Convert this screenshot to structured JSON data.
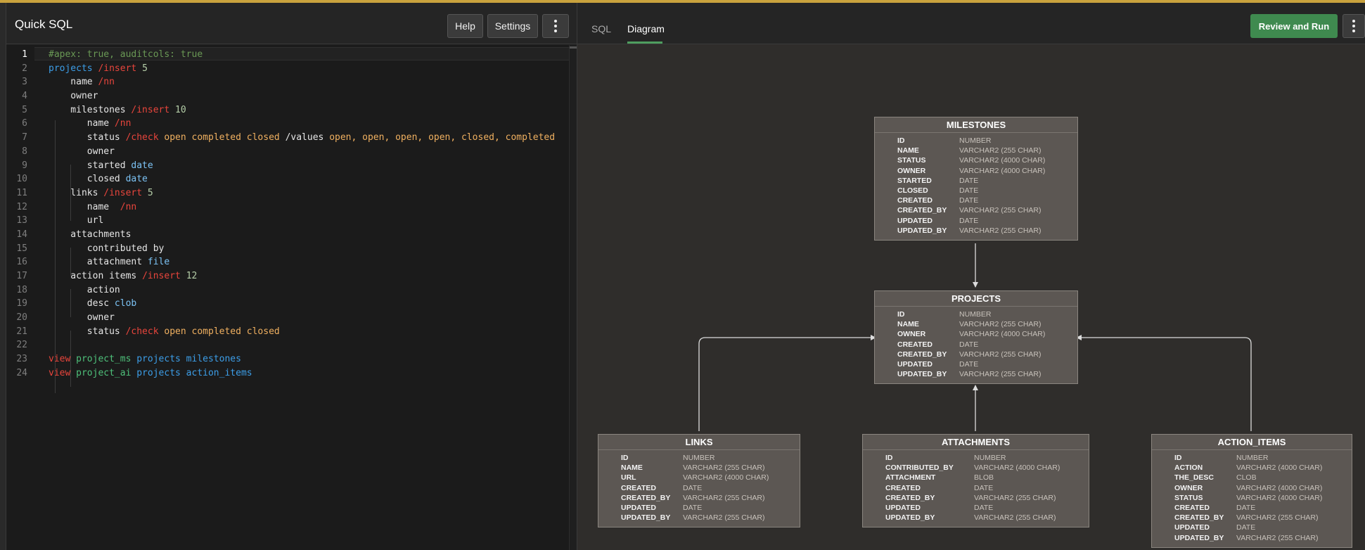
{
  "app": {
    "title": "Quick SQL"
  },
  "toolbar": {
    "help_label": "Help",
    "settings_label": "Settings",
    "more_icon": "kebab-vertical-icon"
  },
  "editor": {
    "line_numbers": [
      "1",
      "2",
      "3",
      "4",
      "5",
      "6",
      "7",
      "8",
      "9",
      "10",
      "11",
      "12",
      "13",
      "14",
      "15",
      "16",
      "17",
      "18",
      "19",
      "20",
      "21",
      "22",
      "23",
      "24"
    ],
    "lines": [
      [
        {
          "t": "#apex: true, auditcols: true",
          "c": "comment"
        }
      ],
      [
        {
          "t": "projects ",
          "c": "table"
        },
        {
          "t": "/insert ",
          "c": "directive"
        },
        {
          "t": "5",
          "c": "number"
        }
      ],
      [
        {
          "t": "    name ",
          "c": "plain"
        },
        {
          "t": "/nn",
          "c": "directive"
        }
      ],
      [
        {
          "t": "    owner",
          "c": "plain"
        }
      ],
      [
        {
          "t": "    milestones ",
          "c": "plain"
        },
        {
          "t": "/insert ",
          "c": "directive"
        },
        {
          "t": "10",
          "c": "number"
        }
      ],
      [
        {
          "t": "       name ",
          "c": "plain"
        },
        {
          "t": "/nn",
          "c": "directive"
        }
      ],
      [
        {
          "t": "       status ",
          "c": "plain"
        },
        {
          "t": "/check ",
          "c": "directive"
        },
        {
          "t": "open completed closed ",
          "c": "value"
        },
        {
          "t": "/values ",
          "c": "plain"
        },
        {
          "t": "open, open, open, open, closed, completed",
          "c": "value"
        }
      ],
      [
        {
          "t": "       owner",
          "c": "plain"
        }
      ],
      [
        {
          "t": "       started ",
          "c": "plain"
        },
        {
          "t": "date",
          "c": "type"
        }
      ],
      [
        {
          "t": "       closed ",
          "c": "plain"
        },
        {
          "t": "date",
          "c": "type"
        }
      ],
      [
        {
          "t": "    links ",
          "c": "plain"
        },
        {
          "t": "/insert ",
          "c": "directive"
        },
        {
          "t": "5",
          "c": "number"
        }
      ],
      [
        {
          "t": "       name  ",
          "c": "plain"
        },
        {
          "t": "/nn",
          "c": "directive"
        }
      ],
      [
        {
          "t": "       url",
          "c": "plain"
        }
      ],
      [
        {
          "t": "    attachments",
          "c": "plain"
        }
      ],
      [
        {
          "t": "       contributed by",
          "c": "plain"
        }
      ],
      [
        {
          "t": "       attachment ",
          "c": "plain"
        },
        {
          "t": "file",
          "c": "type"
        }
      ],
      [
        {
          "t": "    action items ",
          "c": "plain"
        },
        {
          "t": "/insert ",
          "c": "directive"
        },
        {
          "t": "12",
          "c": "number"
        }
      ],
      [
        {
          "t": "       action",
          "c": "plain"
        }
      ],
      [
        {
          "t": "       desc ",
          "c": "plain"
        },
        {
          "t": "clob",
          "c": "type"
        }
      ],
      [
        {
          "t": "       owner",
          "c": "plain"
        }
      ],
      [
        {
          "t": "       status ",
          "c": "plain"
        },
        {
          "t": "/check ",
          "c": "directive"
        },
        {
          "t": "open completed closed",
          "c": "value"
        }
      ],
      [],
      [
        {
          "t": "view ",
          "c": "view"
        },
        {
          "t": "project_ms ",
          "c": "viewname"
        },
        {
          "t": "projects milestones",
          "c": "table"
        }
      ],
      [
        {
          "t": "view ",
          "c": "view"
        },
        {
          "t": "project_ai ",
          "c": "viewname"
        },
        {
          "t": "projects action_items",
          "c": "table"
        }
      ]
    ]
  },
  "tabs": {
    "sql": "SQL",
    "diagram": "Diagram",
    "active": "Diagram"
  },
  "actions": {
    "review_run_label": "Review and Run"
  },
  "colors": {
    "accent_green": "#3f8a4f",
    "window_border": "#c9a23d",
    "comment": "#6a9955",
    "table": "#3c9ee8",
    "directive": "#e8453c",
    "number": "#b5cea8",
    "type": "#7cc3f5",
    "value": "#f0b060"
  },
  "diagram": {
    "entities": [
      {
        "key": "milestones",
        "name": "MILESTONES",
        "columns": [
          {
            "name": "ID",
            "type": "NUMBER"
          },
          {
            "name": "NAME",
            "type": "VARCHAR2 (255 CHAR)"
          },
          {
            "name": "STATUS",
            "type": "VARCHAR2 (4000 CHAR)"
          },
          {
            "name": "OWNER",
            "type": "VARCHAR2 (4000 CHAR)"
          },
          {
            "name": "STARTED",
            "type": "DATE"
          },
          {
            "name": "CLOSED",
            "type": "DATE"
          },
          {
            "name": "CREATED",
            "type": "DATE"
          },
          {
            "name": "CREATED_BY",
            "type": "VARCHAR2 (255 CHAR)"
          },
          {
            "name": "UPDATED",
            "type": "DATE"
          },
          {
            "name": "UPDATED_BY",
            "type": "VARCHAR2 (255 CHAR)"
          }
        ]
      },
      {
        "key": "projects",
        "name": "PROJECTS",
        "columns": [
          {
            "name": "ID",
            "type": "NUMBER"
          },
          {
            "name": "NAME",
            "type": "VARCHAR2 (255 CHAR)"
          },
          {
            "name": "OWNER",
            "type": "VARCHAR2 (4000 CHAR)"
          },
          {
            "name": "CREATED",
            "type": "DATE"
          },
          {
            "name": "CREATED_BY",
            "type": "VARCHAR2 (255 CHAR)"
          },
          {
            "name": "UPDATED",
            "type": "DATE"
          },
          {
            "name": "UPDATED_BY",
            "type": "VARCHAR2 (255 CHAR)"
          }
        ]
      },
      {
        "key": "links",
        "name": "LINKS",
        "columns": [
          {
            "name": "ID",
            "type": "NUMBER"
          },
          {
            "name": "NAME",
            "type": "VARCHAR2 (255 CHAR)"
          },
          {
            "name": "URL",
            "type": "VARCHAR2 (4000 CHAR)"
          },
          {
            "name": "CREATED",
            "type": "DATE"
          },
          {
            "name": "CREATED_BY",
            "type": "VARCHAR2 (255 CHAR)"
          },
          {
            "name": "UPDATED",
            "type": "DATE"
          },
          {
            "name": "UPDATED_BY",
            "type": "VARCHAR2 (255 CHAR)"
          }
        ]
      },
      {
        "key": "attachments",
        "name": "ATTACHMENTS",
        "columns": [
          {
            "name": "ID",
            "type": "NUMBER"
          },
          {
            "name": "CONTRIBUTED_BY",
            "type": "VARCHAR2 (4000 CHAR)"
          },
          {
            "name": "ATTACHMENT",
            "type": "BLOB"
          },
          {
            "name": "CREATED",
            "type": "DATE"
          },
          {
            "name": "CREATED_BY",
            "type": "VARCHAR2 (255 CHAR)"
          },
          {
            "name": "UPDATED",
            "type": "DATE"
          },
          {
            "name": "UPDATED_BY",
            "type": "VARCHAR2 (255 CHAR)"
          }
        ]
      },
      {
        "key": "action_items",
        "name": "ACTION_ITEMS",
        "columns": [
          {
            "name": "ID",
            "type": "NUMBER"
          },
          {
            "name": "ACTION",
            "type": "VARCHAR2 (4000 CHAR)"
          },
          {
            "name": "THE_DESC",
            "type": "CLOB"
          },
          {
            "name": "OWNER",
            "type": "VARCHAR2 (4000 CHAR)"
          },
          {
            "name": "STATUS",
            "type": "VARCHAR2 (4000 CHAR)"
          },
          {
            "name": "CREATED",
            "type": "DATE"
          },
          {
            "name": "CREATED_BY",
            "type": "VARCHAR2 (255 CHAR)"
          },
          {
            "name": "UPDATED",
            "type": "DATE"
          },
          {
            "name": "UPDATED_BY",
            "type": "VARCHAR2 (255 CHAR)"
          }
        ]
      }
    ],
    "relationships": [
      {
        "from": "milestones",
        "to": "projects"
      },
      {
        "from": "links",
        "to": "projects"
      },
      {
        "from": "attachments",
        "to": "projects"
      },
      {
        "from": "action_items",
        "to": "projects"
      }
    ]
  }
}
